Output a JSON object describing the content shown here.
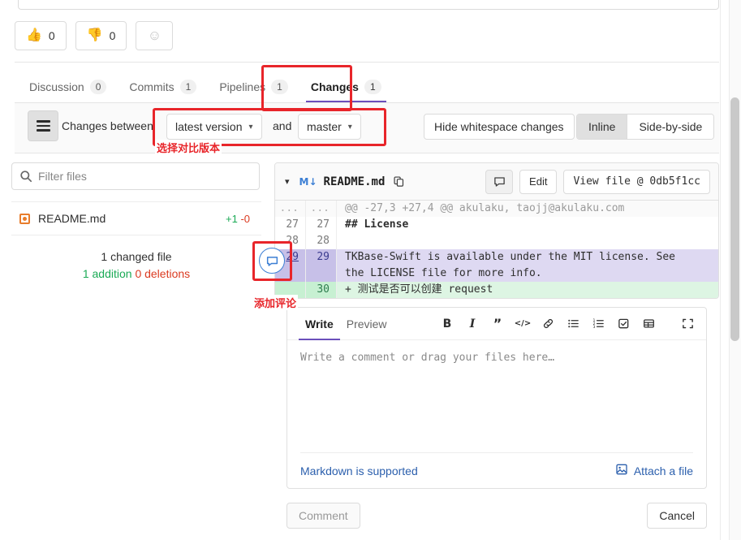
{
  "reactions": [
    {
      "icon": "thumbs-up-emoji",
      "glyph": "👍",
      "count": "0"
    },
    {
      "icon": "thumbs-down-emoji",
      "glyph": "👎",
      "count": "0"
    }
  ],
  "add_reaction": {
    "icon": "smiley-face-icon",
    "glyph": "☺"
  },
  "tabs": [
    {
      "label": "Discussion",
      "badge": "0",
      "active": false
    },
    {
      "label": "Commits",
      "badge": "1",
      "active": false
    },
    {
      "label": "Pipelines",
      "badge": "1",
      "active": false
    },
    {
      "label": "Changes",
      "badge": "1",
      "active": true
    }
  ],
  "compare_bar": {
    "menu_icon": "hamburger-icon",
    "label": "Changes between",
    "source_version": "latest version",
    "and_word": "and",
    "target_version": "master",
    "hide_whitespace": "Hide whitespace changes",
    "view_modes": [
      {
        "label": "Inline",
        "active": true
      },
      {
        "label": "Side-by-side",
        "active": false
      }
    ],
    "caret": "⌄"
  },
  "annotations": [
    {
      "name": "annotation-changes-tab",
      "text": ""
    },
    {
      "name": "annotation-compare-version",
      "text": "选择对比版本"
    },
    {
      "name": "annotation-add-comment",
      "text": "添加评论"
    }
  ],
  "sidebar": {
    "filter_placeholder": "Filter files",
    "filter_value": "",
    "search_icon": "search-icon",
    "files": [
      {
        "icon": "file-modified-icon",
        "name": "README.md",
        "additions": "+1",
        "deletions": "-0"
      }
    ],
    "summary": {
      "changed_files": "1 changed file",
      "additions": "1 addition",
      "deletions": "0 deletions"
    }
  },
  "diff": {
    "chevron_icon": "chevron-down-icon",
    "file_type_badge": "M↓",
    "filename": "README.md",
    "copy_icon": "copy-path-icon",
    "comment_icon": "comment-icon",
    "edit_label": "Edit",
    "view_file_label": "View file @ 0db5f1cc",
    "bubble_icon": "add-comment-bubble-icon",
    "lines": [
      {
        "type": "meta",
        "old": "...",
        "new": "...",
        "code": "@@ -27,3 +27,4 @@ akulaku, taojj@akulaku.com",
        "bold": false
      },
      {
        "type": "normal",
        "old": "27",
        "new": "27",
        "code": "## License",
        "bold": true
      },
      {
        "type": "normal",
        "old": "28",
        "new": "28",
        "code": "",
        "bold": false
      },
      {
        "type": "hover",
        "old": "29",
        "new": "29",
        "code": "TKBase-Swift is available under the MIT license. See\nthe LICENSE file for more info.",
        "bold": false
      },
      {
        "type": "add",
        "old": "",
        "new": "30",
        "code": "+ 测试是否可以创建 request",
        "bold": false
      }
    ]
  },
  "comment_form": {
    "tabs": [
      {
        "label": "Write",
        "active": true
      },
      {
        "label": "Preview",
        "active": false
      }
    ],
    "tools": [
      {
        "name": "bold-icon",
        "glyph": "B"
      },
      {
        "name": "italic-icon",
        "glyph": "I"
      },
      {
        "name": "quote-icon",
        "glyph": "”"
      },
      {
        "name": "code-icon",
        "glyph": "</>"
      },
      {
        "name": "link-icon",
        "glyph": "🔗"
      },
      {
        "name": "bulleted-list-icon",
        "glyph": "☰"
      },
      {
        "name": "numbered-list-icon",
        "glyph": "≡"
      },
      {
        "name": "task-list-icon",
        "glyph": "☑"
      },
      {
        "name": "table-icon",
        "glyph": "▤"
      },
      {
        "name": "fullscreen-icon",
        "glyph": "⤢"
      }
    ],
    "placeholder": "Write a comment or drag your files here…",
    "value": "",
    "markdown_hint": "Markdown is supported",
    "attach_label": "Attach a file",
    "attach_icon": "attach-image-icon",
    "submit_label": "Comment",
    "cancel_label": "Cancel"
  },
  "colors": {
    "accent_purple": "#6b4fbb",
    "addition_green": "#1aaa55",
    "deletion_red": "#db3b21",
    "annotation_red": "#e8252a",
    "link_blue": "#2b5fad",
    "file_modified_orange": "#e87c2b"
  }
}
